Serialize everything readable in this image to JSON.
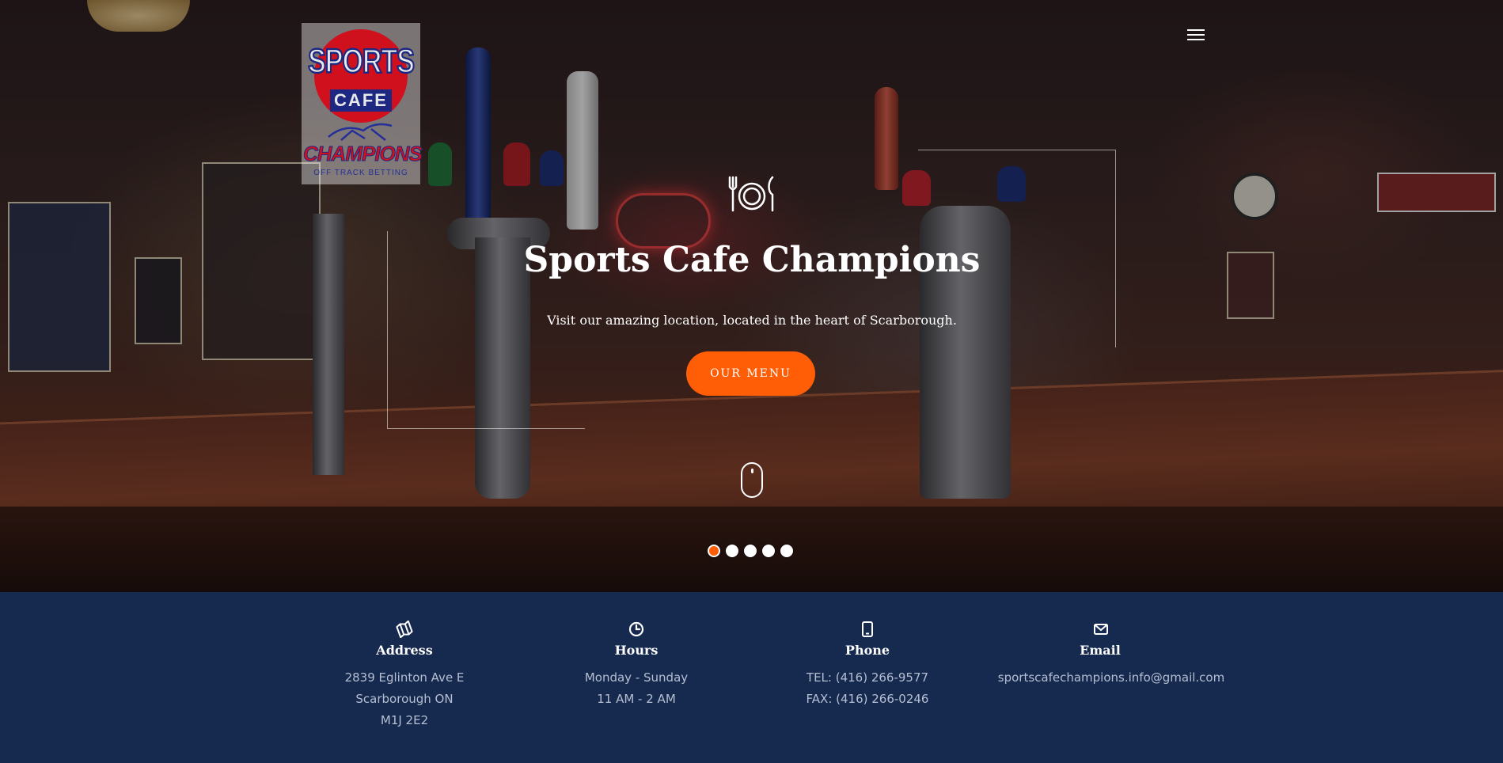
{
  "hero": {
    "title": "Sports Cafe Champions",
    "subtitle": "Visit our amazing location, located in the heart of Scarborough.",
    "cta_label": "OUR MENU",
    "slides": 5,
    "active_slide": 1
  },
  "logo": {
    "line1": "SPORTS",
    "line2": "CAFE",
    "line3": "CHAMPIONS",
    "line4": "OFF TRACK BETTING"
  },
  "info": {
    "address": {
      "icon": "map-icon",
      "title": "Address",
      "lines": [
        "2839 Eglinton Ave E",
        "Scarborough ON",
        "M1J 2E2"
      ]
    },
    "hours": {
      "icon": "clock-icon",
      "title": "Hours",
      "lines": [
        "Monday - Sunday",
        "11 AM - 2 AM"
      ]
    },
    "phone": {
      "icon": "phone-icon",
      "title": "Phone",
      "lines": [
        "TEL: (416) 266-9577",
        "FAX: (416) 266-0246"
      ]
    },
    "email": {
      "icon": "envelope-icon",
      "title": "Email",
      "lines": [
        "sportscafechampions.info@gmail.com"
      ]
    }
  },
  "colors": {
    "accent": "#ff5d06",
    "info_bar": "#16294f",
    "info_text": "#b5bfd1"
  }
}
